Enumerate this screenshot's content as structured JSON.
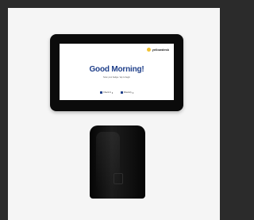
{
  "screen": {
    "logo_text": "yellowdesk",
    "greeting": "Good Morning!",
    "subline": "Scan your badge / tap to begin",
    "options": [
      {
        "label": "Check In"
      },
      {
        "label": "Directory"
      }
    ]
  },
  "colors": {
    "background_frame": "#2b2b2b",
    "photo_background": "#f5f5f5",
    "device_body": "#0b0b0b",
    "greeting_text": "#1f3f8a",
    "logo_accent": "#f2c230"
  },
  "icons": [
    "logo-icon",
    "check-in-icon",
    "directory-icon",
    "chevron-right-icon"
  ]
}
